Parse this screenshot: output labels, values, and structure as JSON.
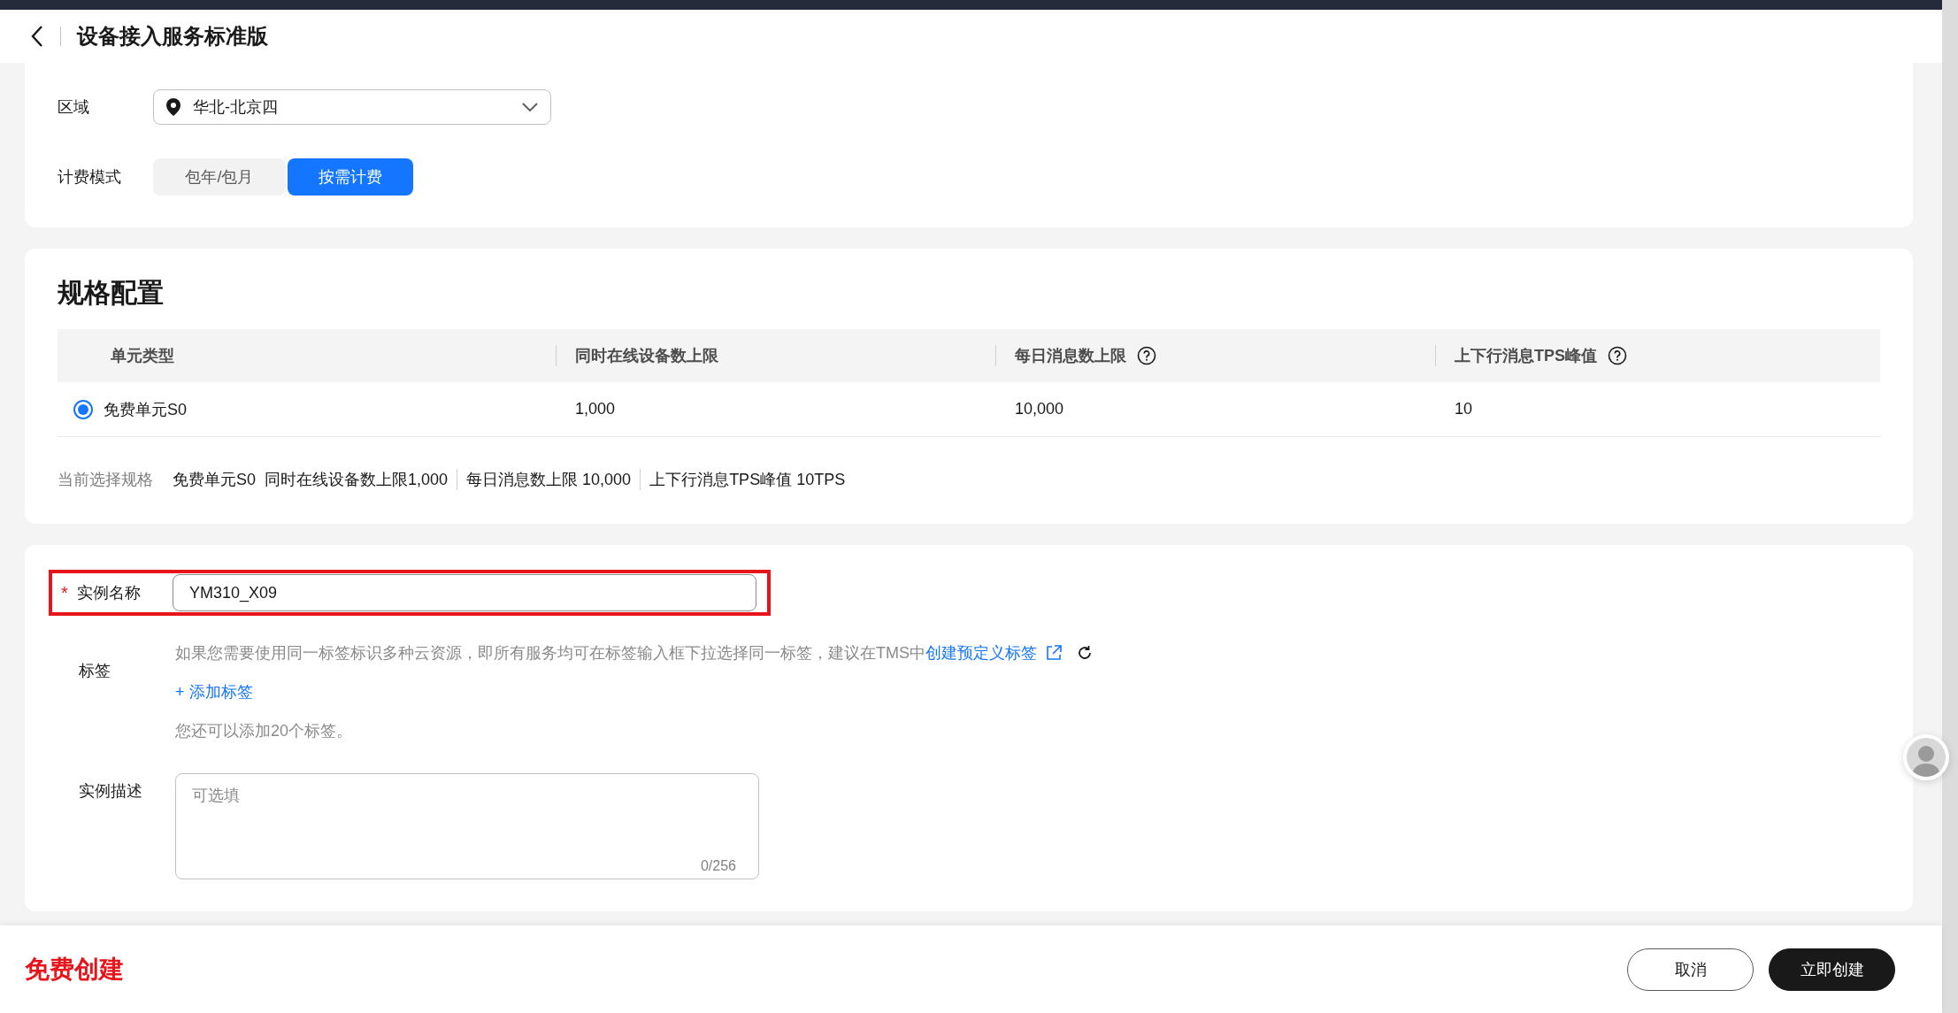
{
  "header": {
    "title": "设备接入服务标准版"
  },
  "basic": {
    "region": {
      "label": "区域",
      "value": "华北-北京四"
    },
    "billing": {
      "label": "计费模式",
      "options": [
        {
          "label": "包年/包月",
          "selected": false
        },
        {
          "label": "按需计费",
          "selected": true
        }
      ]
    }
  },
  "spec": {
    "title": "规格配置",
    "columns": [
      {
        "label": "单元类型",
        "help": false
      },
      {
        "label": "同时在线设备数上限",
        "help": false
      },
      {
        "label": "每日消息数上限",
        "help": true
      },
      {
        "label": "上下行消息TPS峰值",
        "help": true
      }
    ],
    "rows": [
      {
        "selected": true,
        "cells": [
          "免费单元S0",
          "1,000",
          "10,000",
          "10"
        ]
      }
    ],
    "summary": {
      "label": "当前选择规格",
      "items": [
        "免费单元S0  同时在线设备数上限1,000",
        "每日消息数上限 10,000",
        "上下行消息TPS峰值 10TPS"
      ]
    }
  },
  "instance": {
    "name": {
      "label": "实例名称",
      "required_mark": "*",
      "highlighted": true,
      "value": "YM310_X09"
    },
    "tags": {
      "label": "标签",
      "hint": "如果您需要使用同一标签标识多种云资源，即所有服务均可在标签输入框下拉选择同一标签，建议在TMS中",
      "link": "创建预定义标签",
      "add": "+ 添加标签",
      "remaining": "您还可以添加20个标签。"
    },
    "description": {
      "label": "实例描述",
      "placeholder": "可选填",
      "counter": "0/256"
    }
  },
  "footer": {
    "price": "免费创建",
    "buttons": [
      {
        "label": "取消",
        "kind": "secondary"
      },
      {
        "label": "立即创建",
        "kind": "primary"
      }
    ]
  }
}
